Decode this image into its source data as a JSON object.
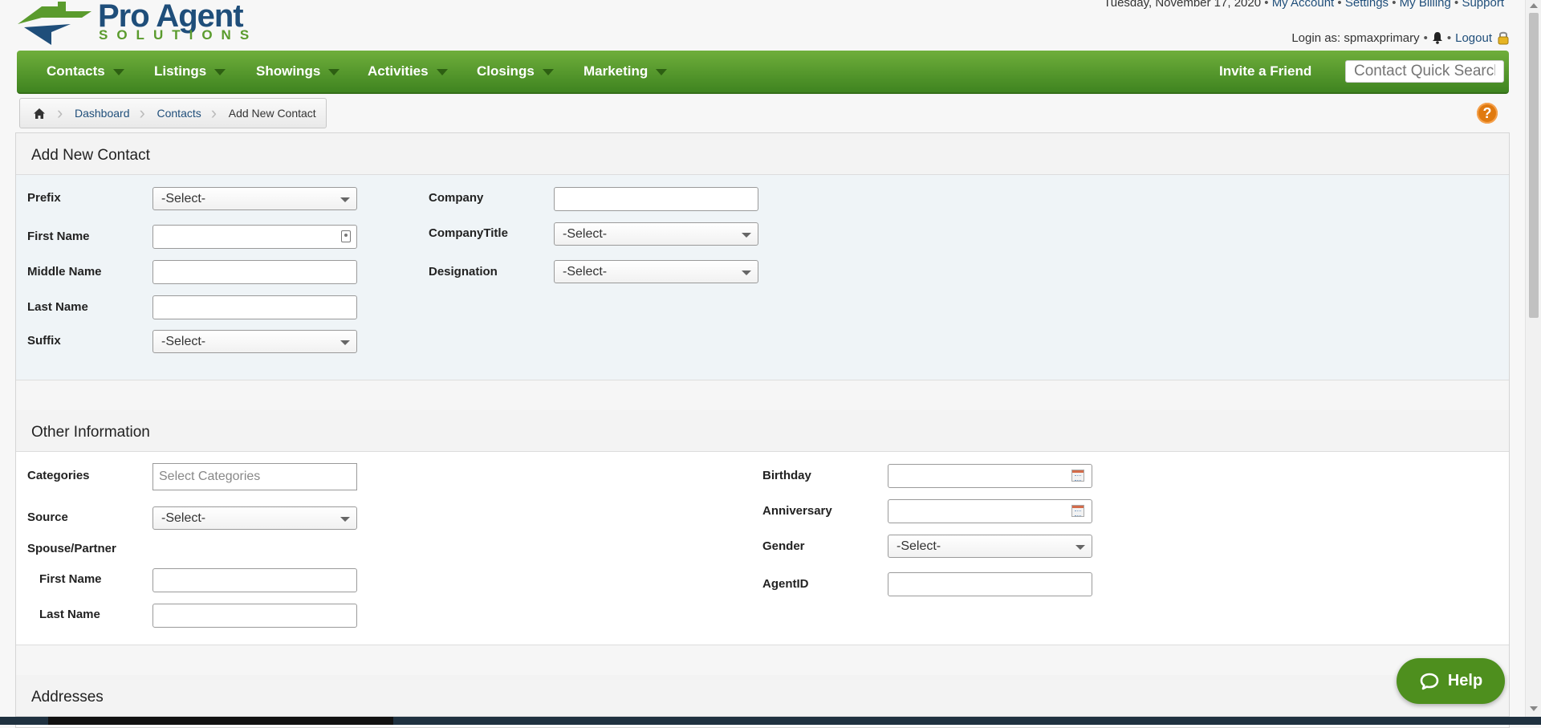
{
  "brand": {
    "name": "Pro Agent",
    "tagline": "SOLUTIONS"
  },
  "topbar": {
    "date": "Tuesday, November 17, 2020",
    "links": [
      "My Account",
      "Settings",
      "My Billing",
      "Support"
    ],
    "login_text": "Login as: spmaxprimary",
    "logout": "Logout"
  },
  "nav": {
    "items": [
      "Contacts",
      "Listings",
      "Showings",
      "Activities",
      "Closings",
      "Marketing"
    ],
    "invite": "Invite a Friend",
    "search_placeholder": "Contact Quick Search"
  },
  "breadcrumb": {
    "items": [
      "Dashboard",
      "Contacts",
      "Add New Contact"
    ]
  },
  "help_icon": "?",
  "section_contact": {
    "title": "Add New Contact",
    "prefix_label": "Prefix",
    "prefix_value": "-Select-",
    "first_name_label": "First Name",
    "middle_name_label": "Middle Name",
    "last_name_label": "Last Name",
    "suffix_label": "Suffix",
    "suffix_value": "-Select-",
    "company_label": "Company",
    "company_title_label": "CompanyTitle",
    "company_title_value": "-Select-",
    "designation_label": "Designation",
    "designation_value": "-Select-"
  },
  "section_other": {
    "title": "Other Information",
    "categories_label": "Categories",
    "categories_placeholder": "Select Categories",
    "source_label": "Source",
    "source_value": "-Select-",
    "spouse_label": "Spouse/Partner",
    "spouse_first_label": "First Name",
    "spouse_last_label": "Last Name",
    "birthday_label": "Birthday",
    "anniversary_label": "Anniversary",
    "gender_label": "Gender",
    "gender_value": "-Select-",
    "agentid_label": "AgentID"
  },
  "section_addresses": {
    "title": "Addresses"
  },
  "help_button": "Help",
  "colors": {
    "nav_green": "#4e8f1e",
    "link_blue": "#1f4e7a",
    "help_orange": "#e07a10"
  }
}
